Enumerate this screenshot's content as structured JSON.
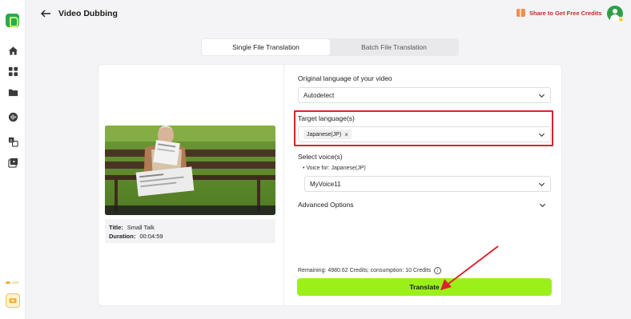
{
  "header": {
    "title": "Video Dubbing",
    "share_label": "Share to Get Free Credits"
  },
  "tabs": [
    {
      "label": "Single File Translation",
      "active": true
    },
    {
      "label": "Batch File Translation",
      "active": false
    }
  ],
  "video": {
    "title_key": "Title:",
    "title_value": "Small Talk",
    "duration_key": "Duration:",
    "duration_value": "00:04:59"
  },
  "form": {
    "original_language_label": "Original language of your video",
    "original_language_value": "Autodetect",
    "target_language_label": "Target language(s)",
    "target_tags": [
      {
        "label": "Japanese(JP)",
        "remove": "×"
      }
    ],
    "voice_label": "Select voice(s)",
    "voice_for_label": "•  Voice for: Japanese(JP)",
    "voice_value": "MyVoice11",
    "advanced_label": "Advanced Options",
    "remaining_text": "Remaining: 4980.62 Credits; consumption: 10 Credits",
    "info_glyph": "i",
    "translate_label": "Translate"
  },
  "colors": {
    "accent_green": "#9cf01a",
    "highlight_red": "#d9232d",
    "brand_green": "#2fa84f"
  },
  "icons": {
    "sidebar": [
      "home-icon",
      "grid-icon",
      "folder-icon",
      "voice-icon",
      "translate-icon",
      "video-icon"
    ]
  }
}
